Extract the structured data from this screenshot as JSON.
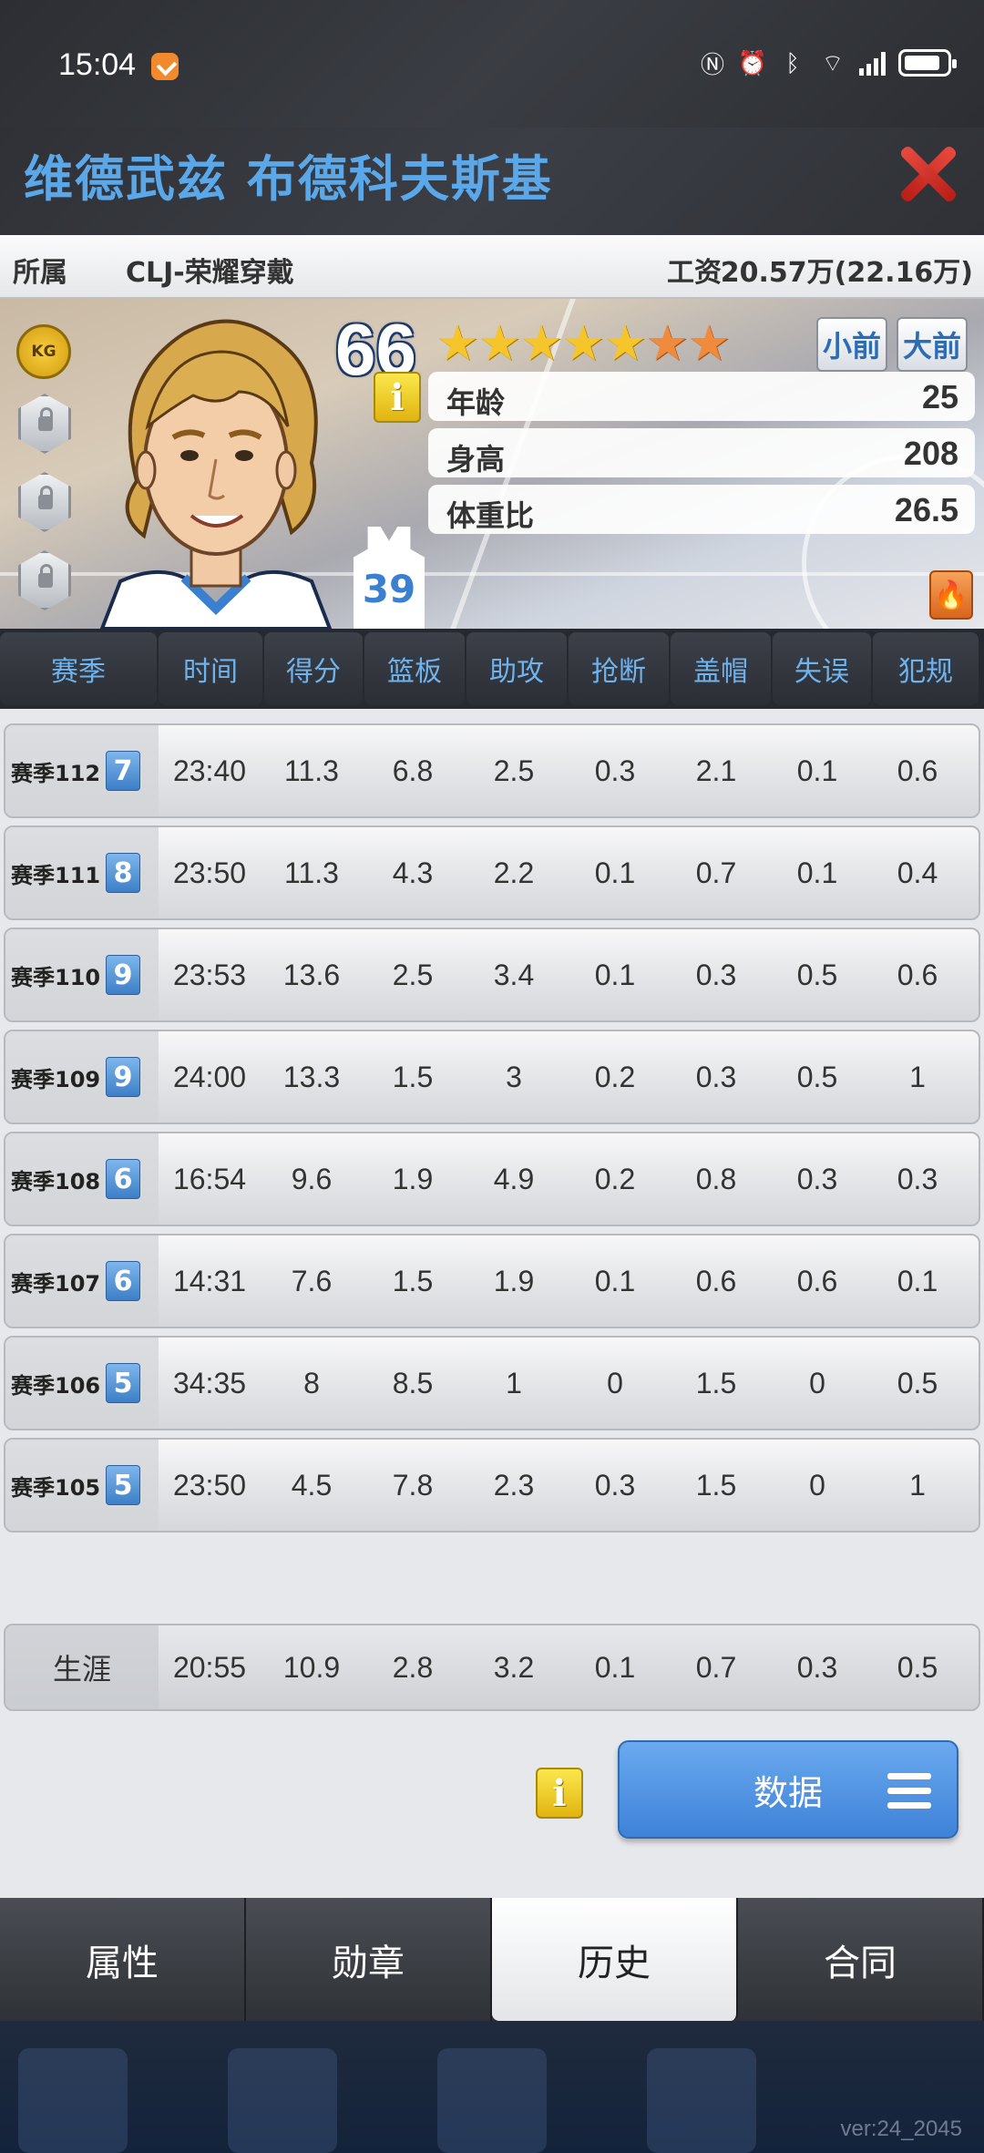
{
  "status": {
    "time": "15:04",
    "icons": [
      "nfc-icon",
      "alarm-icon",
      "bluetooth-icon",
      "wifi-icon",
      "5g-signal-icon",
      "battery-icon"
    ]
  },
  "title": {
    "player_name": "维德武兹 布德科夫斯基"
  },
  "affiliation": {
    "label": "所属",
    "value": "CLJ-荣耀穿戴",
    "salary_label": "工资",
    "salary_value": "20.57万(22.16万)"
  },
  "card": {
    "badge": "KG",
    "overall": "66",
    "stars_gold": 5,
    "stars_orange": 2,
    "jersey_number": "39",
    "sort_small": "小前",
    "sort_big": "大前",
    "info_label": "i",
    "attributes": [
      {
        "label": "年龄",
        "value": "25"
      },
      {
        "label": "身高",
        "value": "208"
      },
      {
        "label": "体重比",
        "value": "26.5"
      }
    ]
  },
  "table": {
    "headers": [
      "赛季",
      "时间",
      "得分",
      "篮板",
      "助攻",
      "抢断",
      "盖帽",
      "失误",
      "犯规"
    ],
    "rows": [
      {
        "season": "赛季112",
        "badge": "7",
        "cells": [
          "23:40",
          "11.3",
          "6.8",
          "2.5",
          "0.3",
          "2.1",
          "0.1",
          "0.6"
        ]
      },
      {
        "season": "赛季111",
        "badge": "8",
        "cells": [
          "23:50",
          "11.3",
          "4.3",
          "2.2",
          "0.1",
          "0.7",
          "0.1",
          "0.4"
        ]
      },
      {
        "season": "赛季110",
        "badge": "9",
        "cells": [
          "23:53",
          "13.6",
          "2.5",
          "3.4",
          "0.1",
          "0.3",
          "0.5",
          "0.6"
        ]
      },
      {
        "season": "赛季109",
        "badge": "9",
        "cells": [
          "24:00",
          "13.3",
          "1.5",
          "3",
          "0.2",
          "0.3",
          "0.5",
          "1"
        ]
      },
      {
        "season": "赛季108",
        "badge": "6",
        "cells": [
          "16:54",
          "9.6",
          "1.9",
          "4.9",
          "0.2",
          "0.8",
          "0.3",
          "0.3"
        ]
      },
      {
        "season": "赛季107",
        "badge": "6",
        "cells": [
          "14:31",
          "7.6",
          "1.5",
          "1.9",
          "0.1",
          "0.6",
          "0.6",
          "0.1"
        ]
      },
      {
        "season": "赛季106",
        "badge": "5",
        "cells": [
          "34:35",
          "8",
          "8.5",
          "1",
          "0",
          "1.5",
          "0",
          "0.5"
        ]
      },
      {
        "season": "赛季105",
        "badge": "5",
        "cells": [
          "23:50",
          "4.5",
          "7.8",
          "2.3",
          "0.3",
          "1.5",
          "0",
          "1"
        ]
      }
    ],
    "career": {
      "label": "生涯",
      "cells": [
        "20:55",
        "10.9",
        "2.8",
        "3.2",
        "0.1",
        "0.7",
        "0.3",
        "0.5"
      ]
    }
  },
  "actions": {
    "info_label": "i",
    "data_button": "数据"
  },
  "tabs": [
    {
      "label": "属性",
      "active": false
    },
    {
      "label": "勋章",
      "active": false
    },
    {
      "label": "历史",
      "active": true
    },
    {
      "label": "合同",
      "active": false
    }
  ],
  "footer": {
    "version": "ver:24_2045"
  },
  "colors": {
    "title_blue": "#5aa8ea",
    "header_text": "#6fb3ee",
    "data_button": "#4f92e2",
    "close_red": "#d63027"
  }
}
